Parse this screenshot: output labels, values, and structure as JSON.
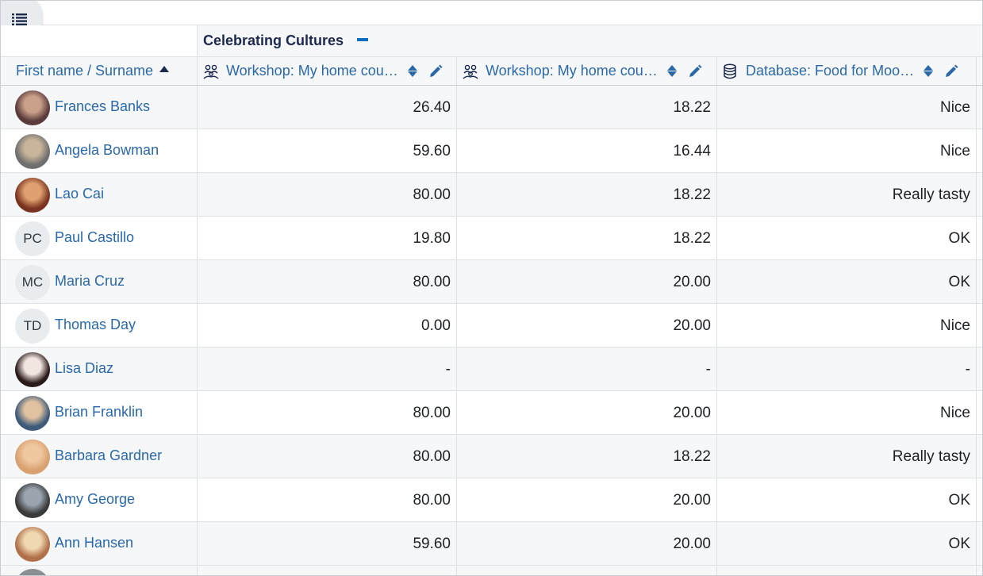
{
  "category": {
    "title": "Celebrating Cultures"
  },
  "headers": {
    "name": "First name / Surname",
    "columns": [
      {
        "label": "Workshop: My home cou…",
        "icon": "workshop-icon"
      },
      {
        "label": "Workshop: My home cou…",
        "icon": "workshop-icon"
      },
      {
        "label": "Database: Food for Moo…",
        "icon": "database-icon"
      }
    ]
  },
  "colors": {
    "link": "#2b68a8",
    "accent": "#0f6cbf",
    "row_alt": "#f5f7f9"
  },
  "students": [
    {
      "name": "Frances Banks",
      "avatar": "photo",
      "initials": "",
      "grades": [
        "26.40",
        "18.22",
        "Nice"
      ]
    },
    {
      "name": "Angela Bowman",
      "avatar": "photo",
      "initials": "",
      "grades": [
        "59.60",
        "16.44",
        "Nice"
      ]
    },
    {
      "name": "Lao Cai",
      "avatar": "photo",
      "initials": "",
      "grades": [
        "80.00",
        "18.22",
        "Really tasty"
      ]
    },
    {
      "name": "Paul Castillo",
      "avatar": "initials",
      "initials": "PC",
      "grades": [
        "19.80",
        "18.22",
        "OK"
      ]
    },
    {
      "name": "Maria Cruz",
      "avatar": "initials",
      "initials": "MC",
      "grades": [
        "80.00",
        "20.00",
        "OK"
      ]
    },
    {
      "name": "Thomas Day",
      "avatar": "initials",
      "initials": "TD",
      "grades": [
        "0.00",
        "20.00",
        "Nice"
      ]
    },
    {
      "name": "Lisa Diaz",
      "avatar": "photo",
      "initials": "",
      "grades": [
        "-",
        "-",
        "-"
      ]
    },
    {
      "name": "Brian Franklin",
      "avatar": "photo",
      "initials": "",
      "grades": [
        "80.00",
        "20.00",
        "Nice"
      ]
    },
    {
      "name": "Barbara Gardner",
      "avatar": "photo",
      "initials": "",
      "grades": [
        "80.00",
        "18.22",
        "Really tasty"
      ]
    },
    {
      "name": "Amy George",
      "avatar": "photo",
      "initials": "",
      "grades": [
        "80.00",
        "20.00",
        "OK"
      ]
    },
    {
      "name": "Ann Hansen",
      "avatar": "photo",
      "initials": "",
      "grades": [
        "59.60",
        "20.00",
        "OK"
      ]
    }
  ]
}
